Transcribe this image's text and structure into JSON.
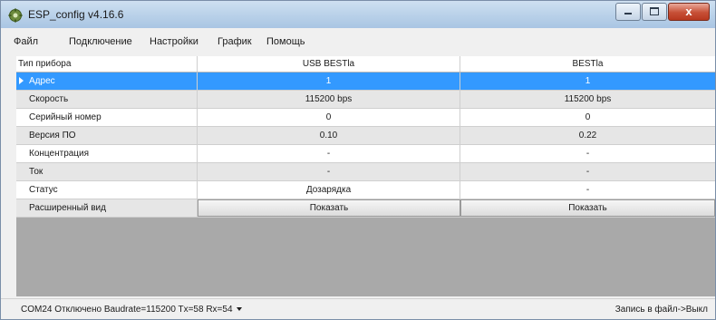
{
  "window": {
    "title": "ESP_config v4.16.6",
    "close_glyph": "x",
    "accent": "#3399ff"
  },
  "menu": [
    "Файл",
    "Подключение",
    "Настройки",
    "График",
    "Помощь"
  ],
  "grid": {
    "columns": [
      "Тип прибора",
      "USB BESTla",
      "BESTla"
    ],
    "rows": [
      {
        "label": "Адрес",
        "v1": "1",
        "v2": "1"
      },
      {
        "label": "Скорость",
        "v1": "115200 bps",
        "v2": "115200 bps"
      },
      {
        "label": "Серийный номер",
        "v1": "0",
        "v2": "0"
      },
      {
        "label": "Версия ПО",
        "v1": "0.10",
        "v2": "0.22"
      },
      {
        "label": "Концентрация",
        "v1": "-",
        "v2": "-"
      },
      {
        "label": "Ток",
        "v1": "-",
        "v2": "-"
      },
      {
        "label": "Статус",
        "v1": "Дозарядка",
        "v2": "-"
      },
      {
        "label": "Расширенный вид",
        "v1": "Показать",
        "v2": "Показать"
      }
    ]
  },
  "status": {
    "left": "COM24 Отключено Baudrate=115200 Tx=58 Rx=54",
    "right": "Запись в файл->Выкл"
  }
}
